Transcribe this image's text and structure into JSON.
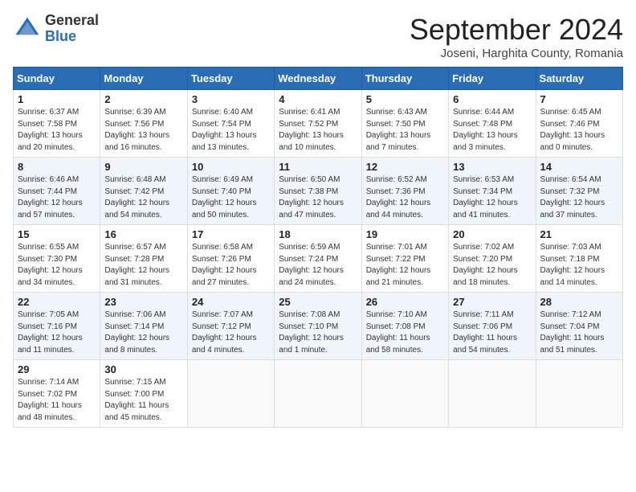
{
  "header": {
    "logo_general": "General",
    "logo_blue": "Blue",
    "month_title": "September 2024",
    "location": "Joseni, Harghita County, Romania"
  },
  "days_of_week": [
    "Sunday",
    "Monday",
    "Tuesday",
    "Wednesday",
    "Thursday",
    "Friday",
    "Saturday"
  ],
  "weeks": [
    [
      {
        "day": "1",
        "sunrise": "Sunrise: 6:37 AM",
        "sunset": "Sunset: 7:58 PM",
        "daylight": "Daylight: 13 hours and 20 minutes."
      },
      {
        "day": "2",
        "sunrise": "Sunrise: 6:39 AM",
        "sunset": "Sunset: 7:56 PM",
        "daylight": "Daylight: 13 hours and 16 minutes."
      },
      {
        "day": "3",
        "sunrise": "Sunrise: 6:40 AM",
        "sunset": "Sunset: 7:54 PM",
        "daylight": "Daylight: 13 hours and 13 minutes."
      },
      {
        "day": "4",
        "sunrise": "Sunrise: 6:41 AM",
        "sunset": "Sunset: 7:52 PM",
        "daylight": "Daylight: 13 hours and 10 minutes."
      },
      {
        "day": "5",
        "sunrise": "Sunrise: 6:43 AM",
        "sunset": "Sunset: 7:50 PM",
        "daylight": "Daylight: 13 hours and 7 minutes."
      },
      {
        "day": "6",
        "sunrise": "Sunrise: 6:44 AM",
        "sunset": "Sunset: 7:48 PM",
        "daylight": "Daylight: 13 hours and 3 minutes."
      },
      {
        "day": "7",
        "sunrise": "Sunrise: 6:45 AM",
        "sunset": "Sunset: 7:46 PM",
        "daylight": "Daylight: 13 hours and 0 minutes."
      }
    ],
    [
      {
        "day": "8",
        "sunrise": "Sunrise: 6:46 AM",
        "sunset": "Sunset: 7:44 PM",
        "daylight": "Daylight: 12 hours and 57 minutes."
      },
      {
        "day": "9",
        "sunrise": "Sunrise: 6:48 AM",
        "sunset": "Sunset: 7:42 PM",
        "daylight": "Daylight: 12 hours and 54 minutes."
      },
      {
        "day": "10",
        "sunrise": "Sunrise: 6:49 AM",
        "sunset": "Sunset: 7:40 PM",
        "daylight": "Daylight: 12 hours and 50 minutes."
      },
      {
        "day": "11",
        "sunrise": "Sunrise: 6:50 AM",
        "sunset": "Sunset: 7:38 PM",
        "daylight": "Daylight: 12 hours and 47 minutes."
      },
      {
        "day": "12",
        "sunrise": "Sunrise: 6:52 AM",
        "sunset": "Sunset: 7:36 PM",
        "daylight": "Daylight: 12 hours and 44 minutes."
      },
      {
        "day": "13",
        "sunrise": "Sunrise: 6:53 AM",
        "sunset": "Sunset: 7:34 PM",
        "daylight": "Daylight: 12 hours and 41 minutes."
      },
      {
        "day": "14",
        "sunrise": "Sunrise: 6:54 AM",
        "sunset": "Sunset: 7:32 PM",
        "daylight": "Daylight: 12 hours and 37 minutes."
      }
    ],
    [
      {
        "day": "15",
        "sunrise": "Sunrise: 6:55 AM",
        "sunset": "Sunset: 7:30 PM",
        "daylight": "Daylight: 12 hours and 34 minutes."
      },
      {
        "day": "16",
        "sunrise": "Sunrise: 6:57 AM",
        "sunset": "Sunset: 7:28 PM",
        "daylight": "Daylight: 12 hours and 31 minutes."
      },
      {
        "day": "17",
        "sunrise": "Sunrise: 6:58 AM",
        "sunset": "Sunset: 7:26 PM",
        "daylight": "Daylight: 12 hours and 27 minutes."
      },
      {
        "day": "18",
        "sunrise": "Sunrise: 6:59 AM",
        "sunset": "Sunset: 7:24 PM",
        "daylight": "Daylight: 12 hours and 24 minutes."
      },
      {
        "day": "19",
        "sunrise": "Sunrise: 7:01 AM",
        "sunset": "Sunset: 7:22 PM",
        "daylight": "Daylight: 12 hours and 21 minutes."
      },
      {
        "day": "20",
        "sunrise": "Sunrise: 7:02 AM",
        "sunset": "Sunset: 7:20 PM",
        "daylight": "Daylight: 12 hours and 18 minutes."
      },
      {
        "day": "21",
        "sunrise": "Sunrise: 7:03 AM",
        "sunset": "Sunset: 7:18 PM",
        "daylight": "Daylight: 12 hours and 14 minutes."
      }
    ],
    [
      {
        "day": "22",
        "sunrise": "Sunrise: 7:05 AM",
        "sunset": "Sunset: 7:16 PM",
        "daylight": "Daylight: 12 hours and 11 minutes."
      },
      {
        "day": "23",
        "sunrise": "Sunrise: 7:06 AM",
        "sunset": "Sunset: 7:14 PM",
        "daylight": "Daylight: 12 hours and 8 minutes."
      },
      {
        "day": "24",
        "sunrise": "Sunrise: 7:07 AM",
        "sunset": "Sunset: 7:12 PM",
        "daylight": "Daylight: 12 hours and 4 minutes."
      },
      {
        "day": "25",
        "sunrise": "Sunrise: 7:08 AM",
        "sunset": "Sunset: 7:10 PM",
        "daylight": "Daylight: 12 hours and 1 minute."
      },
      {
        "day": "26",
        "sunrise": "Sunrise: 7:10 AM",
        "sunset": "Sunset: 7:08 PM",
        "daylight": "Daylight: 11 hours and 58 minutes."
      },
      {
        "day": "27",
        "sunrise": "Sunrise: 7:11 AM",
        "sunset": "Sunset: 7:06 PM",
        "daylight": "Daylight: 11 hours and 54 minutes."
      },
      {
        "day": "28",
        "sunrise": "Sunrise: 7:12 AM",
        "sunset": "Sunset: 7:04 PM",
        "daylight": "Daylight: 11 hours and 51 minutes."
      }
    ],
    [
      {
        "day": "29",
        "sunrise": "Sunrise: 7:14 AM",
        "sunset": "Sunset: 7:02 PM",
        "daylight": "Daylight: 11 hours and 48 minutes."
      },
      {
        "day": "30",
        "sunrise": "Sunrise: 7:15 AM",
        "sunset": "Sunset: 7:00 PM",
        "daylight": "Daylight: 11 hours and 45 minutes."
      },
      null,
      null,
      null,
      null,
      null
    ]
  ]
}
